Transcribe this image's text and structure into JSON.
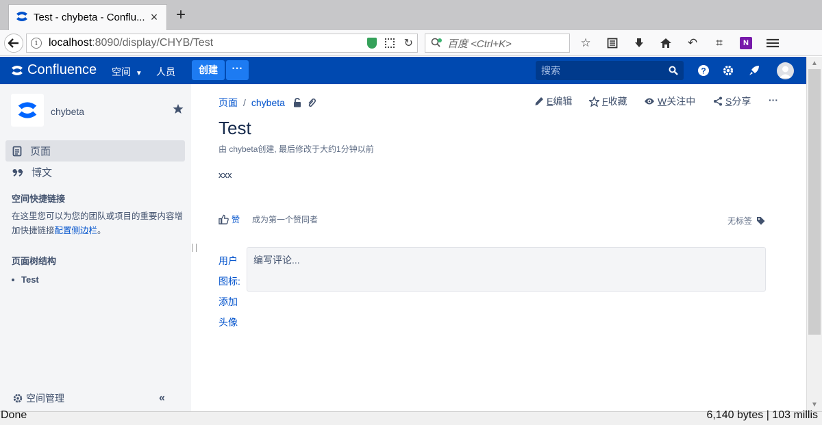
{
  "browser": {
    "tab_title": "Test - chybeta - Conflu...",
    "tab_close": "×",
    "new_tab": "+",
    "url_host": "localhost",
    "url_path": ":8090/display/CHYB/Test",
    "search_placeholder": "百度 <Ctrl+K>",
    "colors": {
      "tab_bg": "#f9f9fa",
      "strip_bg": "#c7c7c9",
      "shield": "#35a15a",
      "onenote": "#7719aa"
    }
  },
  "header": {
    "product": "Confluence",
    "spaces_menu": "空间",
    "people_menu": "人员",
    "create_button": "创建",
    "more_button": "···",
    "search_placeholder": "搜索",
    "colors": {
      "bg": "#0049b0",
      "create_bg": "#1d7bf2",
      "search_bg": "#003a8c"
    }
  },
  "sidebar": {
    "space_name": "chybeta",
    "items": [
      {
        "label": "页面",
        "icon": "pages-icon",
        "active": true
      },
      {
        "label": "博文",
        "icon": "quote-icon",
        "active": false
      }
    ],
    "shortcuts_heading": "空间快捷链接",
    "shortcuts_text": "在这里您可以为您的团队或项目的重要内容增加快捷链接",
    "shortcuts_link": "配置侧边栏",
    "shortcuts_suffix": "。",
    "tree_heading": "页面树结构",
    "tree_items": [
      "Test"
    ],
    "space_admin": "空间管理",
    "collapse": "«"
  },
  "page": {
    "breadcrumb": [
      "页面",
      "chybeta"
    ],
    "breadcrumb_sep": "/",
    "actions": [
      {
        "key": "E",
        "label": "编辑",
        "icon": "pencil-icon"
      },
      {
        "key": "F",
        "label": "收藏",
        "icon": "star-outline-icon"
      },
      {
        "key": "W",
        "label": "关注中",
        "icon": "eye-icon"
      },
      {
        "key": "S",
        "label": "分享",
        "icon": "share-icon"
      }
    ],
    "more_actions": "···",
    "title": "Test",
    "meta": "由 chybeta创建, 最后修改于大约1分钟以前",
    "body": "xxx",
    "like": "赞",
    "first_like": "成为第一个赞同者",
    "no_labels": "无标签",
    "avatar_alt": "用户图标: 添加头像",
    "comment_placeholder": "编写评论..."
  },
  "status": {
    "left": "Done",
    "right": "6,140 bytes | 103 millis"
  }
}
